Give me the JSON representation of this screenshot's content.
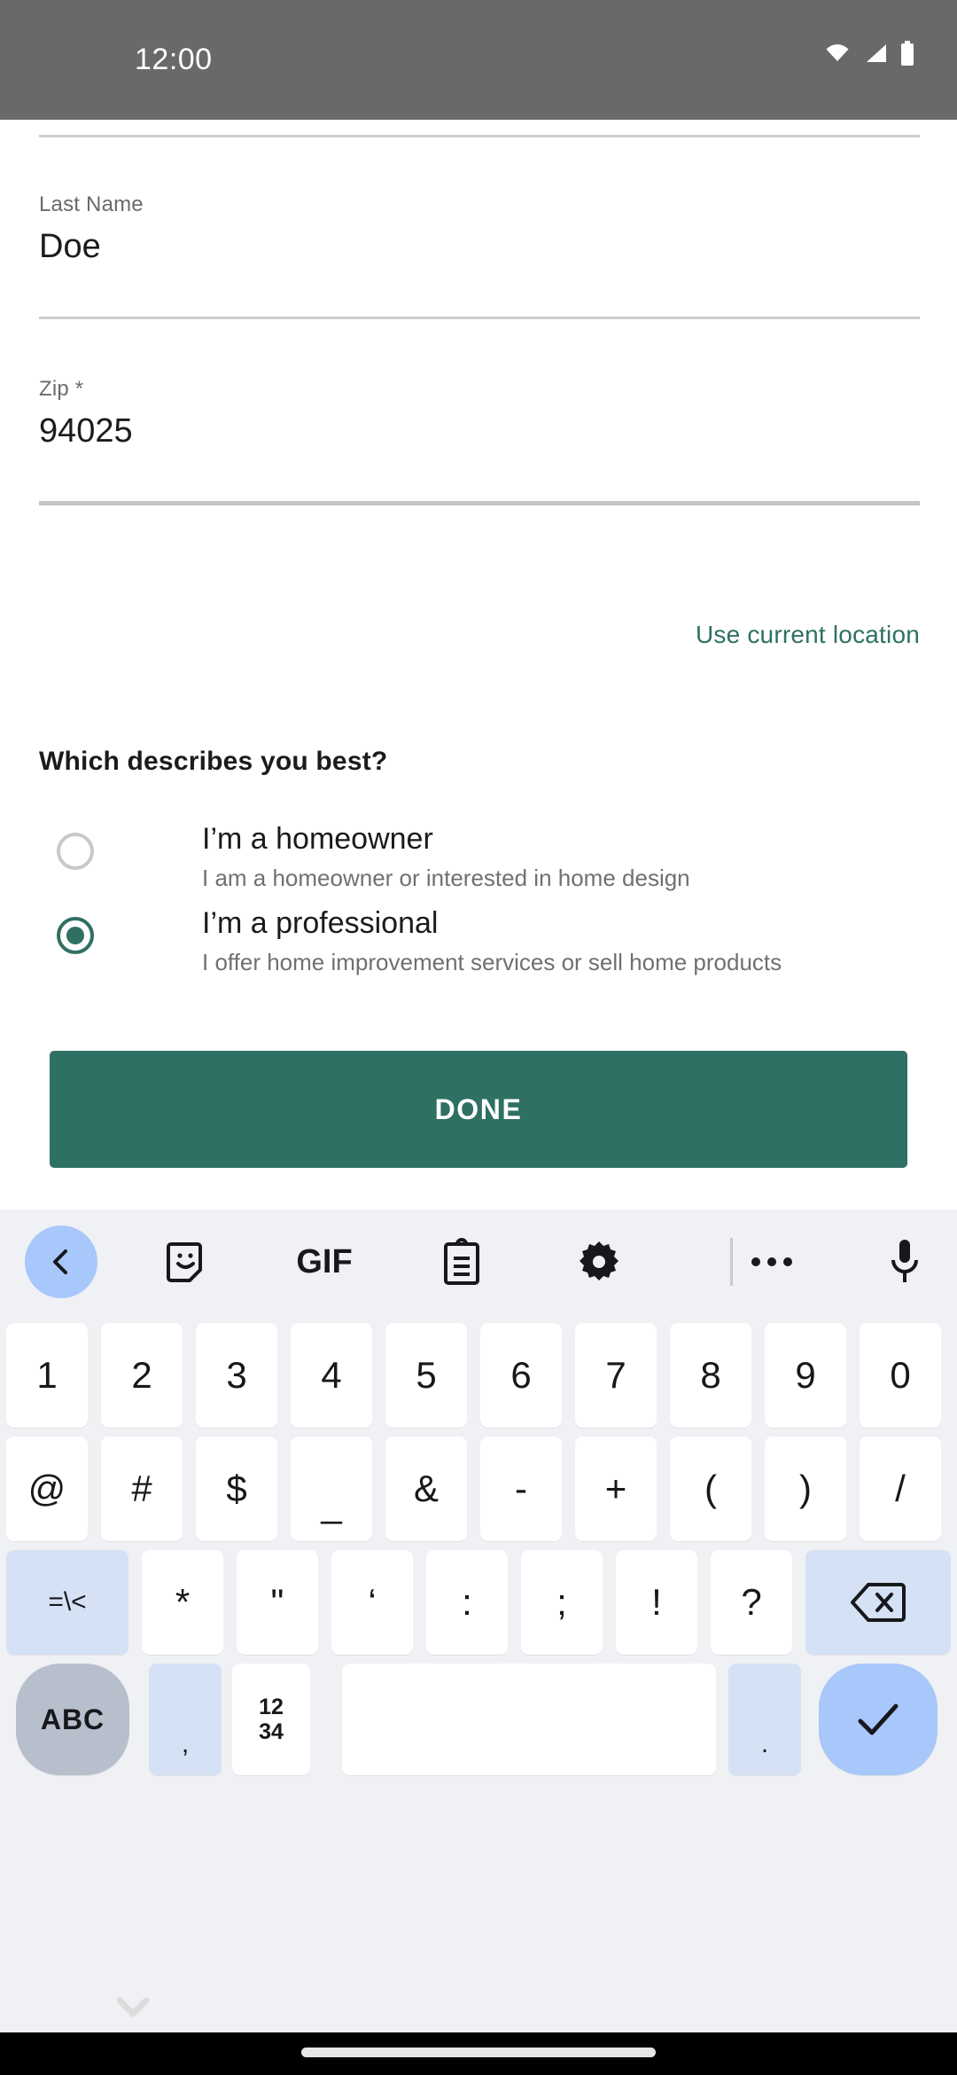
{
  "status_bar": {
    "time": "12:00",
    "icons": [
      "wifi-icon",
      "cell-signal-icon",
      "battery-icon"
    ],
    "background_color": "#696969"
  },
  "theme": {
    "accent_color": "#2E7063",
    "radio_selected_color": "#2F7063",
    "radio_unselected_color": "#C9C9C9",
    "divider_color": "#CCCCCC",
    "keyboard_background": "#F0F1F4",
    "keyboard_key_background": "#FFFFFF",
    "keyboard_fn_key_background": "#D5E1F5",
    "keyboard_enter_background": "#A8C7FA",
    "keyboard_abc_background": "#B8BFCC"
  },
  "form": {
    "fields": [
      {
        "label": "Last Name",
        "value": "Doe",
        "placeholder": "Last Name",
        "focused": false
      },
      {
        "label": "Zip *",
        "value": "94025",
        "placeholder": "Zip *",
        "focused": true
      }
    ],
    "location_link": "Use current location",
    "question": "Which describes you best?",
    "options": [
      {
        "title": "I’m a homeowner",
        "description": "I am a homeowner or interested in home design",
        "selected": false
      },
      {
        "title": "I’m a professional",
        "description": "I offer home improvement services or sell home products",
        "selected": true
      }
    ],
    "submit_label": "DONE"
  },
  "keyboard": {
    "toolbar": [
      {
        "name": "back-icon",
        "label": "‹"
      },
      {
        "name": "sticker-icon",
        "label": ""
      },
      {
        "name": "gif-icon",
        "label": "GIF"
      },
      {
        "name": "clipboard-icon",
        "label": ""
      },
      {
        "name": "gear-icon",
        "label": ""
      },
      {
        "name": "more-icon",
        "label": "•••"
      },
      {
        "name": "mic-icon",
        "label": ""
      }
    ],
    "rows": {
      "numbers": [
        "1",
        "2",
        "3",
        "4",
        "5",
        "6",
        "7",
        "8",
        "9",
        "0"
      ],
      "symbols_1": [
        "@",
        "#",
        "$",
        "_",
        "&",
        "-",
        "+",
        "(",
        ")",
        "/"
      ],
      "symbols_2": [
        "=\\<",
        "*",
        "\"",
        "‘",
        ":",
        ";",
        "!",
        "?",
        "backspace-icon"
      ],
      "bottom": [
        "ABC",
        ",",
        "1234",
        "space",
        ".",
        "enter-check-icon"
      ]
    },
    "alt_layout_key": "=\\<",
    "letters_key": "ABC",
    "numeric_key_line1": "12",
    "numeric_key_line2": "34",
    "comma_key": ",",
    "period_key": ".",
    "hide_keyboard_icon": "chevron-down-icon"
  },
  "nav_bar": {
    "home_indicator": "home-pill"
  }
}
